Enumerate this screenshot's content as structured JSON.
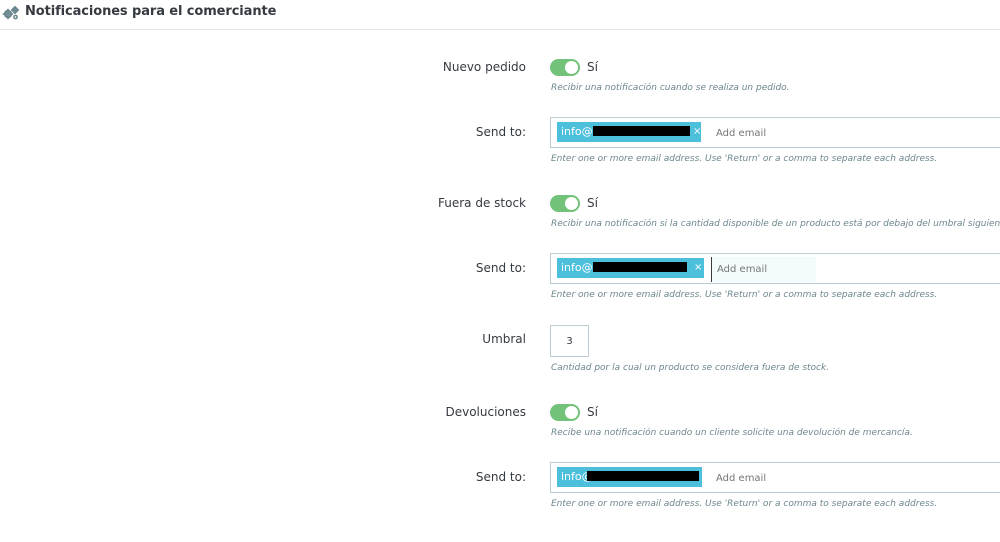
{
  "header": {
    "title": "Notificaciones para el comerciante",
    "icon": "gears-icon"
  },
  "sections": {
    "nuevo_pedido": {
      "label": "Nuevo pedido",
      "toggle_value": "Sí",
      "help": "Recibir una notificación cuando se realiza un pedido.",
      "send_to_label": "Send to:",
      "email_tag": "info@",
      "email_placeholder": "Add email",
      "email_help": "Enter one or more email address. Use 'Return' or a comma to separate each address."
    },
    "fuera_de_stock": {
      "label": "Fuera de stock",
      "toggle_value": "Sí",
      "help": "Recibir una notificación si la cantidad disponible de un producto está por debajo del umbral siguiente.",
      "send_to_label": "Send to:",
      "email_tag": "info@",
      "email_placeholder": "Add email",
      "email_help": "Enter one or more email address. Use 'Return' or a comma to separate each address."
    },
    "umbral": {
      "label": "Umbral",
      "value": "3",
      "help": "Cantidad por la cual un producto se considera fuera de stock."
    },
    "devoluciones": {
      "label": "Devoluciones",
      "toggle_value": "Sí",
      "help": "Recibe una notificación cuando un cliente solicite una devolución de mercancía.",
      "send_to_label": "Send to:",
      "email_tag": "info@",
      "email_placeholder": "Add email",
      "email_help": "Enter one or more email address. Use 'Return' or a comma to separate each address."
    }
  },
  "colors": {
    "toggle_on": "#72c279",
    "tag": "#4cbfdb",
    "border": "#bbcdd2",
    "help_text": "#6c868e"
  }
}
